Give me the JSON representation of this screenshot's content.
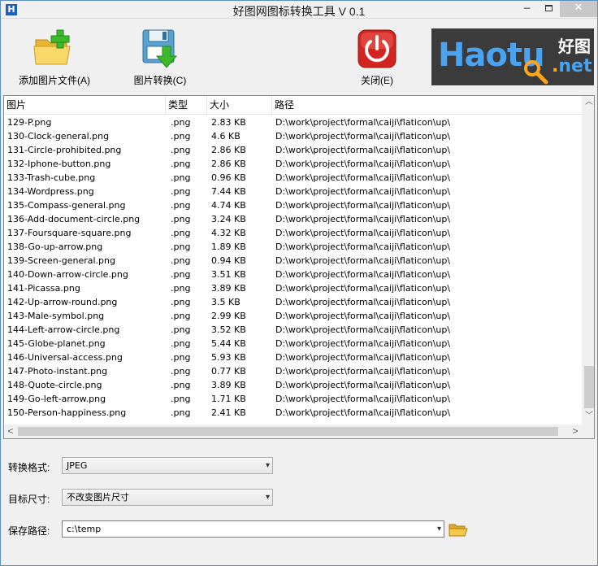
{
  "window": {
    "title": "好图网图标转换工具 V 0.1",
    "app_icon": "H",
    "min_glyph": "−",
    "close_glyph": "✕"
  },
  "toolbar": {
    "add_label": "添加图片文件(A)",
    "convert_label": "图片转换(C)",
    "close_label": "关闭(E)"
  },
  "logo": {
    "brand": "Haotu",
    "chinese": "好图",
    "domain_dot": ".",
    "domain": "net"
  },
  "list": {
    "columns": {
      "name": "图片",
      "type": "类型",
      "size": "大小",
      "path": "路径"
    },
    "rows": [
      {
        "name": "129-P.png",
        "type": ".png",
        "size": "2.83 KB",
        "path": "D:\\work\\project\\formal\\caiji\\flaticon\\up\\"
      },
      {
        "name": "130-Clock-general.png",
        "type": ".png",
        "size": "4.6 KB",
        "path": "D:\\work\\project\\formal\\caiji\\flaticon\\up\\"
      },
      {
        "name": "131-Circle-prohibited.png",
        "type": ".png",
        "size": "2.86 KB",
        "path": "D:\\work\\project\\formal\\caiji\\flaticon\\up\\"
      },
      {
        "name": "132-Iphone-button.png",
        "type": ".png",
        "size": "2.86 KB",
        "path": "D:\\work\\project\\formal\\caiji\\flaticon\\up\\"
      },
      {
        "name": "133-Trash-cube.png",
        "type": ".png",
        "size": "0.96 KB",
        "path": "D:\\work\\project\\formal\\caiji\\flaticon\\up\\"
      },
      {
        "name": "134-Wordpress.png",
        "type": ".png",
        "size": "7.44 KB",
        "path": "D:\\work\\project\\formal\\caiji\\flaticon\\up\\"
      },
      {
        "name": "135-Compass-general.png",
        "type": ".png",
        "size": "4.74 KB",
        "path": "D:\\work\\project\\formal\\caiji\\flaticon\\up\\"
      },
      {
        "name": "136-Add-document-circle.png",
        "type": ".png",
        "size": "3.24 KB",
        "path": "D:\\work\\project\\formal\\caiji\\flaticon\\up\\"
      },
      {
        "name": "137-Foursquare-square.png",
        "type": ".png",
        "size": "4.32 KB",
        "path": "D:\\work\\project\\formal\\caiji\\flaticon\\up\\"
      },
      {
        "name": "138-Go-up-arrow.png",
        "type": ".png",
        "size": "1.89 KB",
        "path": "D:\\work\\project\\formal\\caiji\\flaticon\\up\\"
      },
      {
        "name": "139-Screen-general.png",
        "type": ".png",
        "size": "0.94 KB",
        "path": "D:\\work\\project\\formal\\caiji\\flaticon\\up\\"
      },
      {
        "name": "140-Down-arrow-circle.png",
        "type": ".png",
        "size": "3.51 KB",
        "path": "D:\\work\\project\\formal\\caiji\\flaticon\\up\\"
      },
      {
        "name": "141-Picassa.png",
        "type": ".png",
        "size": "3.89 KB",
        "path": "D:\\work\\project\\formal\\caiji\\flaticon\\up\\"
      },
      {
        "name": "142-Up-arrow-round.png",
        "type": ".png",
        "size": "3.5 KB",
        "path": "D:\\work\\project\\formal\\caiji\\flaticon\\up\\"
      },
      {
        "name": "143-Male-symbol.png",
        "type": ".png",
        "size": "2.99 KB",
        "path": "D:\\work\\project\\formal\\caiji\\flaticon\\up\\"
      },
      {
        "name": "144-Left-arrow-circle.png",
        "type": ".png",
        "size": "3.52 KB",
        "path": "D:\\work\\project\\formal\\caiji\\flaticon\\up\\"
      },
      {
        "name": "145-Globe-planet.png",
        "type": ".png",
        "size": "5.44 KB",
        "path": "D:\\work\\project\\formal\\caiji\\flaticon\\up\\"
      },
      {
        "name": "146-Universal-access.png",
        "type": ".png",
        "size": "5.93 KB",
        "path": "D:\\work\\project\\formal\\caiji\\flaticon\\up\\"
      },
      {
        "name": "147-Photo-instant.png",
        "type": ".png",
        "size": "0.77 KB",
        "path": "D:\\work\\project\\formal\\caiji\\flaticon\\up\\"
      },
      {
        "name": "148-Quote-circle.png",
        "type": ".png",
        "size": "3.89 KB",
        "path": "D:\\work\\project\\formal\\caiji\\flaticon\\up\\"
      },
      {
        "name": "149-Go-left-arrow.png",
        "type": ".png",
        "size": "1.71 KB",
        "path": "D:\\work\\project\\formal\\caiji\\flaticon\\up\\"
      },
      {
        "name": "150-Person-happiness.png",
        "type": ".png",
        "size": "2.41 KB",
        "path": "D:\\work\\project\\formal\\caiji\\flaticon\\up\\"
      }
    ]
  },
  "settings": {
    "format_label": "转换格式:",
    "format_value": "JPEG",
    "size_label": "目标尺寸:",
    "size_value": "不改变图片尺寸",
    "path_label": "保存路径:",
    "path_value": "c:\\temp"
  },
  "icons": {
    "scroll_up": "︿",
    "scroll_down": "﹀",
    "scroll_left": "<",
    "scroll_right": ">",
    "caret": "▾"
  },
  "colors": {
    "window_border": "#5a8fc8",
    "logo_bg": "#3b3b3b",
    "logo_blue": "#4aa3f0",
    "logo_orange": "#ffa51f",
    "close_red": "#d4241f",
    "folder_yellow": "#f5c84a",
    "plus_green": "#3cb92c"
  }
}
